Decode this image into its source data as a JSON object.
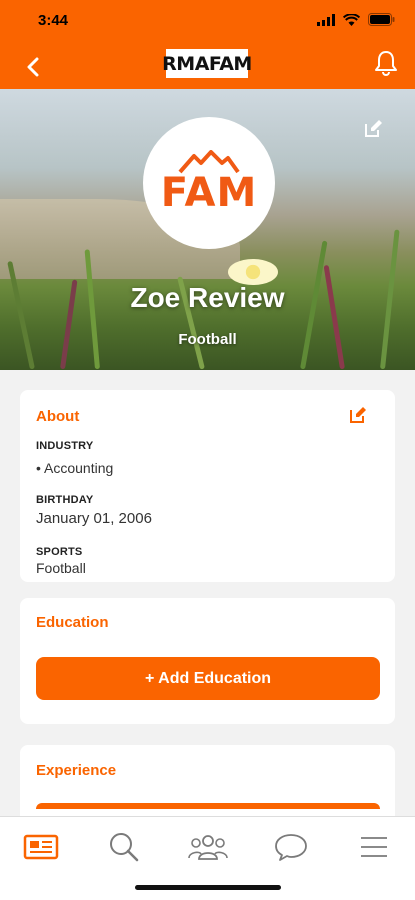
{
  "status_bar": {
    "time": "3:44"
  },
  "header": {
    "logo_text": "RMAFAM"
  },
  "profile": {
    "avatar_text": "FAM",
    "name": "Zoe Review",
    "sport": "Football"
  },
  "about": {
    "title": "About",
    "fields": [
      {
        "label": "INDUSTRY",
        "value": "• Accounting"
      },
      {
        "label": "BIRTHDAY",
        "value": "January 01, 2006"
      },
      {
        "label": "SPORTS",
        "value": "Football"
      }
    ]
  },
  "education": {
    "title": "Education",
    "button_label": "+ Add Education"
  },
  "experience": {
    "title": "Experience"
  },
  "colors": {
    "accent": "#fa6400",
    "tab_inactive": "#7a7a7a"
  },
  "tabs": [
    {
      "icon": "feed-icon",
      "active": true
    },
    {
      "icon": "search-icon",
      "active": false
    },
    {
      "icon": "people-icon",
      "active": false
    },
    {
      "icon": "chat-icon",
      "active": false
    },
    {
      "icon": "menu-icon",
      "active": false
    }
  ]
}
